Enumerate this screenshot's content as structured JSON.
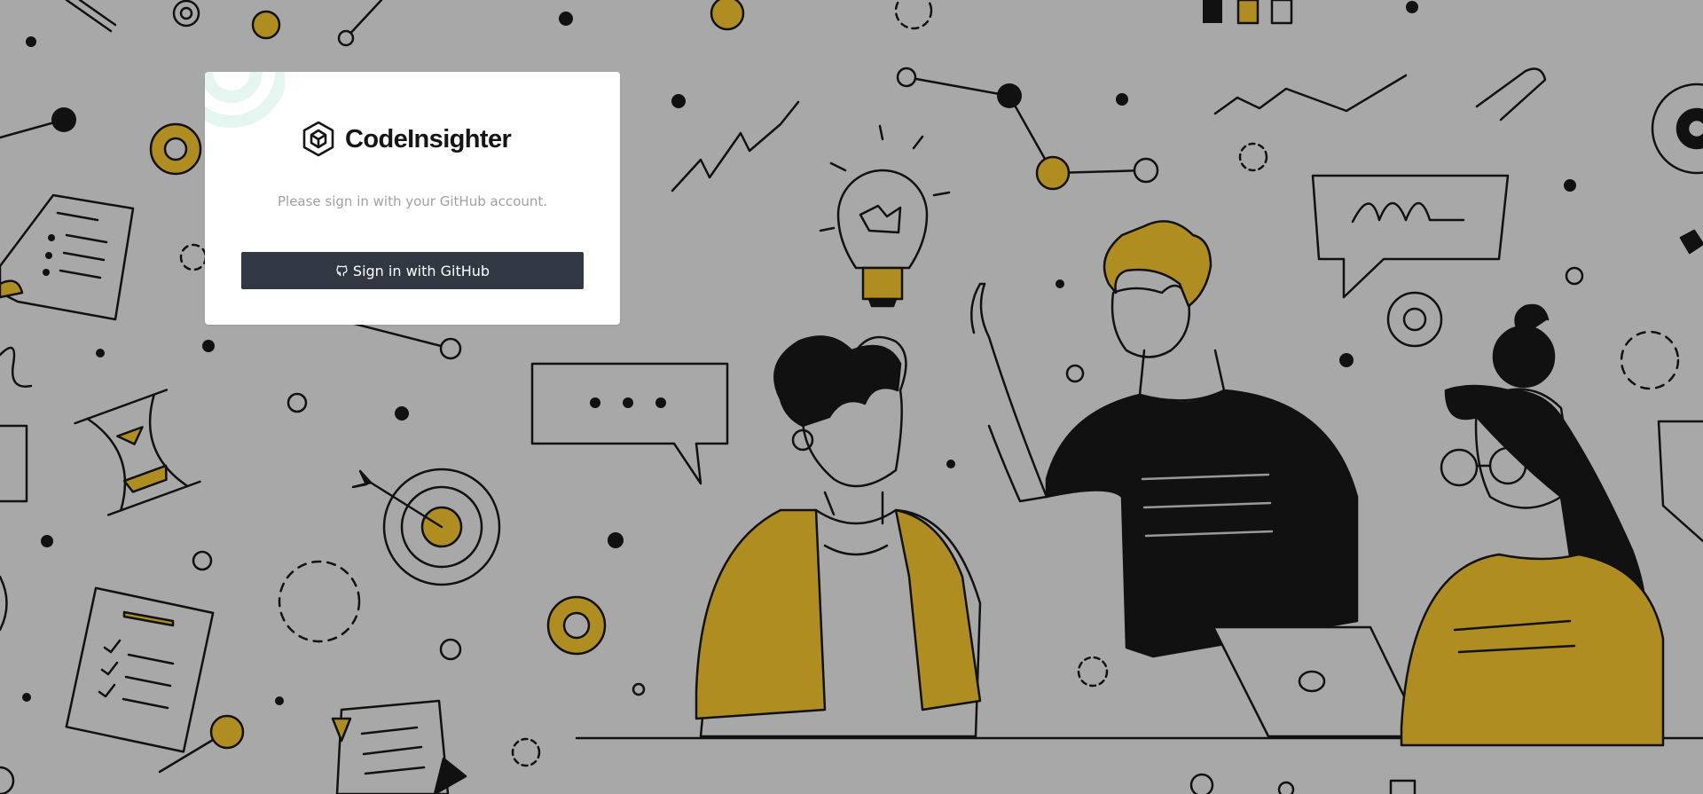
{
  "brand": {
    "name": "CodeInsighter",
    "logo_icon": "hexagon-cube-icon"
  },
  "signin": {
    "message": "Please sign in with your GitHub account.",
    "button_label": "Sign in with GitHub",
    "button_icon": "github-icon"
  },
  "background": {
    "illustration": "team-collaboration-illustration"
  },
  "colors": {
    "background": "#a8a8a8",
    "card": "#ffffff",
    "button": "#323843",
    "accent": "#b08d21",
    "ink": "#151515",
    "subtitle": "#9da1a6"
  }
}
